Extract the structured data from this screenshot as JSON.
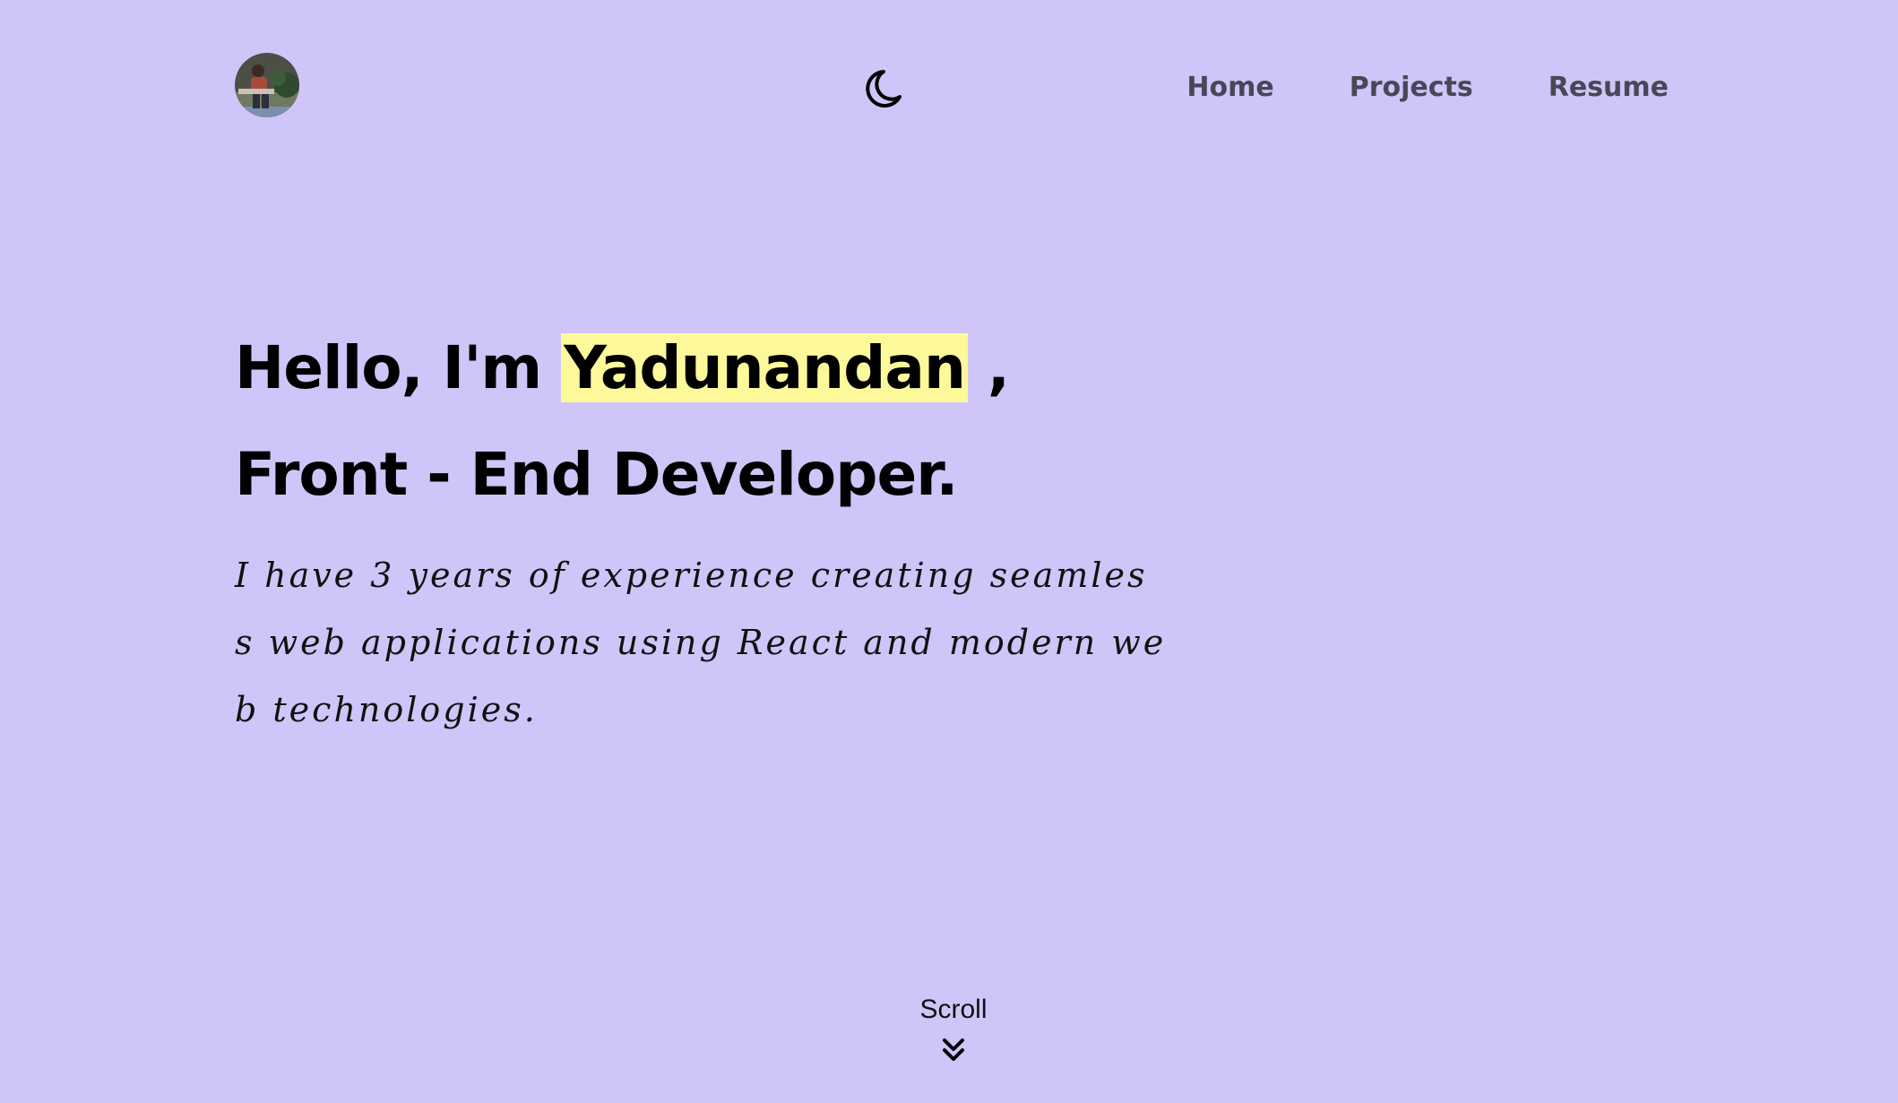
{
  "header": {
    "avatar_alt": "Profile photo",
    "theme_icon": "moon-icon",
    "nav": [
      {
        "label": "Home"
      },
      {
        "label": "Projects"
      },
      {
        "label": "Resume"
      }
    ]
  },
  "hero": {
    "greeting": "Hello, I'm",
    "name": "Yadunandan",
    "comma": ",",
    "role": "Front - End Developer.",
    "bio": "I have 3 years of experience creating seamless web applications using React and modern web technologies."
  },
  "scroll": {
    "label": "Scroll",
    "icon": "double-chevron-down-icon"
  },
  "colors": {
    "background": "#cfc5f8",
    "name_highlight": "#fdf99a",
    "nav_text": "#4a4656"
  }
}
